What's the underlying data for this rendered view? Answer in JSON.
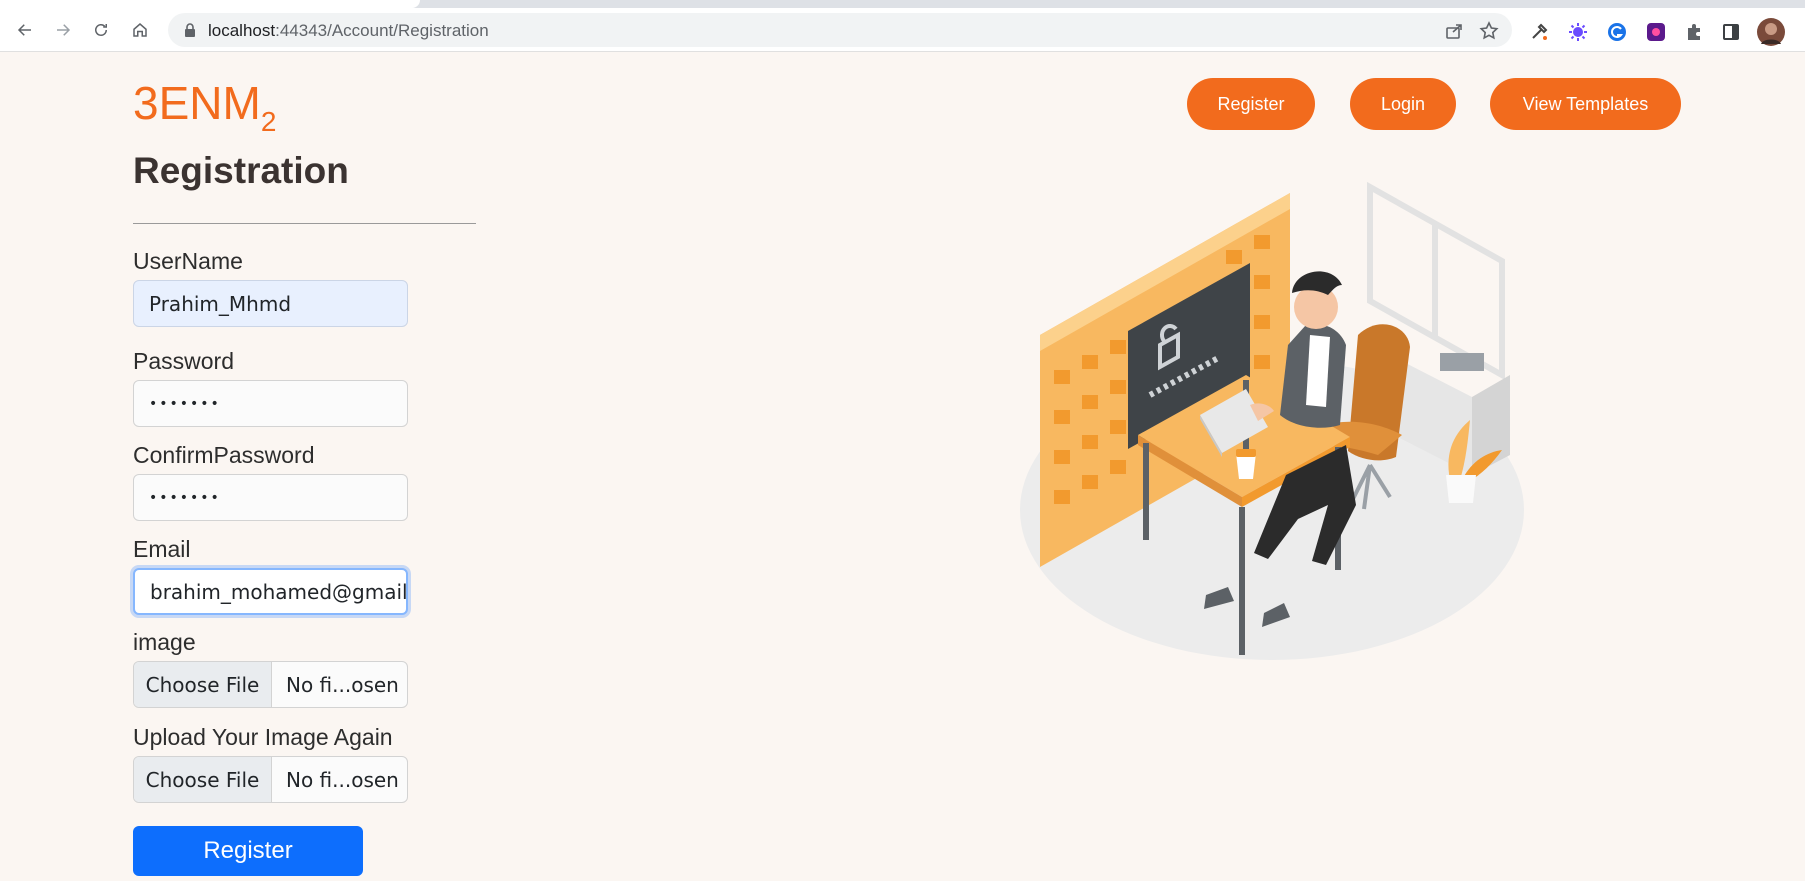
{
  "browser": {
    "url_host": "localhost",
    "url_rest": ":44343/Account/Registration"
  },
  "site": {
    "logo_main": "3ENM",
    "logo_sub": "2"
  },
  "nav": {
    "register": "Register",
    "login": "Login",
    "view_templates": "View Templates"
  },
  "form": {
    "title": "Registration",
    "username_label": "UserName",
    "username_value": "Prahim_Mhmd",
    "password_label": "Password",
    "password_value": "•••••••",
    "confirm_label": "ConfirmPassword",
    "confirm_value": "•••••••",
    "email_label": "Email",
    "email_value": "brahim_mohamed@gmail.c",
    "image_label": "image",
    "image_button": "Choose File",
    "image_status": "No fi...osen",
    "image_again_label": "Upload Your Image Again",
    "image_again_button": "Choose File",
    "image_again_status": "No fi...osen",
    "submit": "Register"
  },
  "colors": {
    "brand": "#f26b1d",
    "primary": "#0d6efd",
    "background": "#fbf6f2"
  }
}
